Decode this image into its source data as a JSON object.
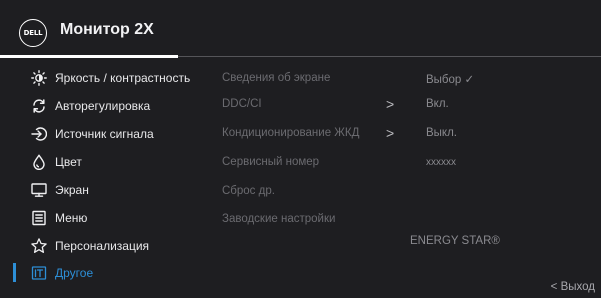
{
  "header": {
    "logo_text": "DELL",
    "title": "Монитор 2X"
  },
  "menu": [
    {
      "label": "Яркость / контрастность",
      "icon": "brightness-icon"
    },
    {
      "label": "Авторегулировка",
      "icon": "auto-adjust-icon"
    },
    {
      "label": "Источник сигнала",
      "icon": "input-source-icon"
    },
    {
      "label": "Цвет",
      "icon": "color-icon"
    },
    {
      "label": "Экран",
      "icon": "display-icon"
    },
    {
      "label": "Меню",
      "icon": "menu-icon"
    },
    {
      "label": "Персонализация",
      "icon": "star-icon"
    },
    {
      "label": "Другое",
      "icon": "other-icon",
      "active": true
    }
  ],
  "options": [
    {
      "label": "Сведения об экране",
      "value": "Выбор ✓"
    },
    {
      "label": "DDC/CI",
      "value": "Вкл.",
      "arrow": ">"
    },
    {
      "label": "Кондиционирование ЖКД",
      "value": "Выкл.",
      "arrow": ">"
    },
    {
      "label": "Сервисный номер",
      "value": "xxxxxx"
    },
    {
      "label": "Сброс др.",
      "value": ""
    },
    {
      "label": "Заводские настройки",
      "value": ""
    }
  ],
  "energy_star": "ENERGY STAR®",
  "footer": {
    "exit_label": "< Выход"
  },
  "colors": {
    "accent": "#2d8fd7",
    "background": "#1e1e21"
  }
}
